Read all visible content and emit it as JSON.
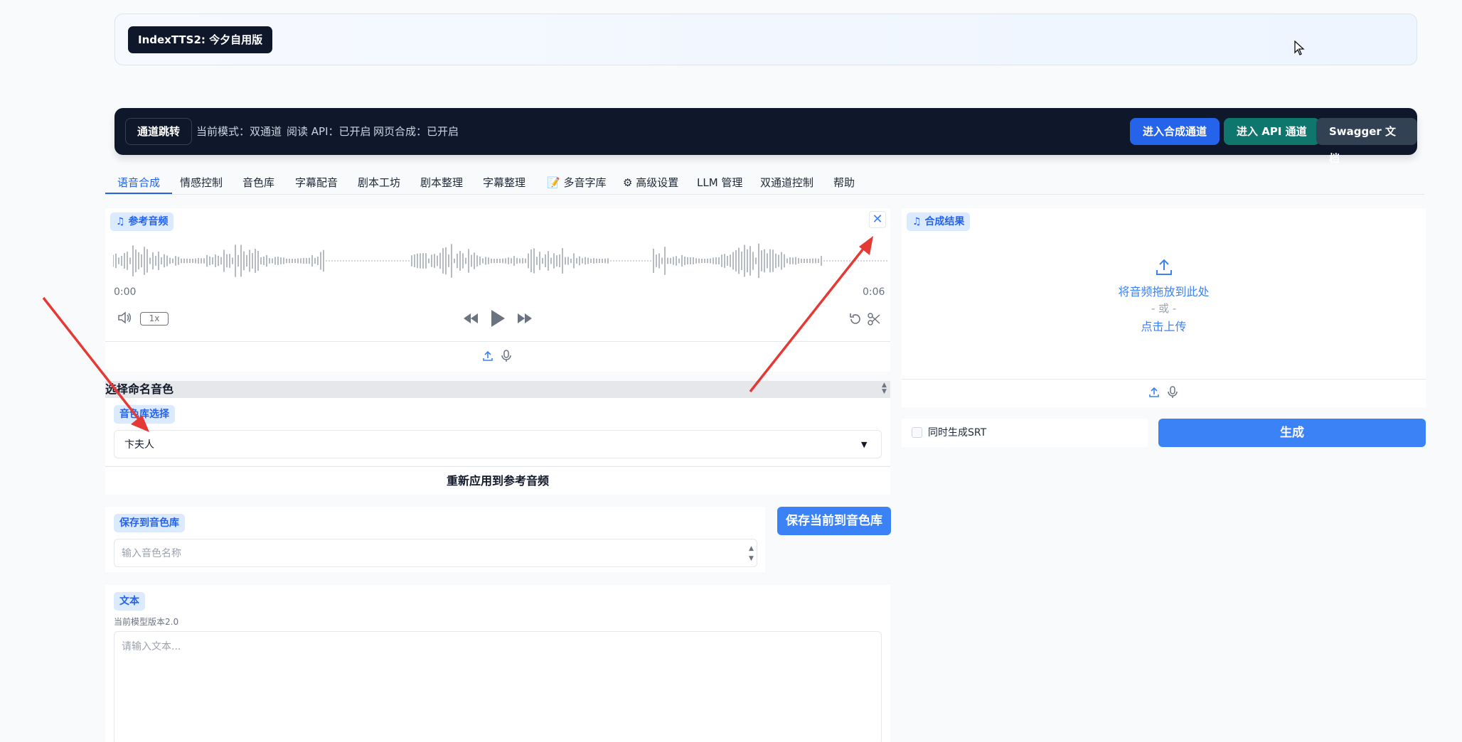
{
  "banner": {
    "app_title": "IndexTTS2: 今夕自用版"
  },
  "navbar": {
    "route_button": "通道跳转",
    "status_mode": "当前模式：双通道",
    "status_api": "阅读 API：已开启",
    "status_web": "网页合成：已开启",
    "btn_synth": "进入合成通道",
    "btn_api": "进入 API 通道",
    "btn_swagger": "Swagger 文档",
    "colors": {
      "synth": "#2563eb",
      "api": "#0f766e",
      "swagger": "#334155"
    }
  },
  "tabs": [
    {
      "label": "语音合成",
      "active": true
    },
    {
      "label": "情感控制"
    },
    {
      "label": "音色库"
    },
    {
      "label": "字幕配音"
    },
    {
      "label": "剧本工坊"
    },
    {
      "label": "剧本整理"
    },
    {
      "label": "字幕整理"
    },
    {
      "label": "多音字库",
      "icon": "notebook-icon"
    },
    {
      "label": "高级设置",
      "icon": "gear-icon"
    },
    {
      "label": "LLM 管理"
    },
    {
      "label": "双通道控制"
    },
    {
      "label": "帮助"
    }
  ],
  "ref_audio": {
    "label": "参考音频",
    "time_start": "0:00",
    "time_end": "0:06",
    "speed": "1x"
  },
  "voice_select": {
    "section_title": "选择命名音色",
    "label": "音色库选择",
    "value": "卞夫人",
    "reapply_button": "重新应用到参考音频"
  },
  "save_voice": {
    "label": "保存到音色库",
    "placeholder": "输入音色名称",
    "button": "保存当前到音色库"
  },
  "text_input": {
    "label": "文本",
    "model_version": "当前模型版本2.0",
    "placeholder": "请输入文本..."
  },
  "result": {
    "label": "合成结果",
    "drop_text": "将音频拖放到此处",
    "or_text": "- 或 -",
    "click_upload": "点击上传",
    "srt_label": "同时生成SRT",
    "srt_checked": false,
    "generate_button": "生成"
  },
  "annotation_color": "#e53935"
}
